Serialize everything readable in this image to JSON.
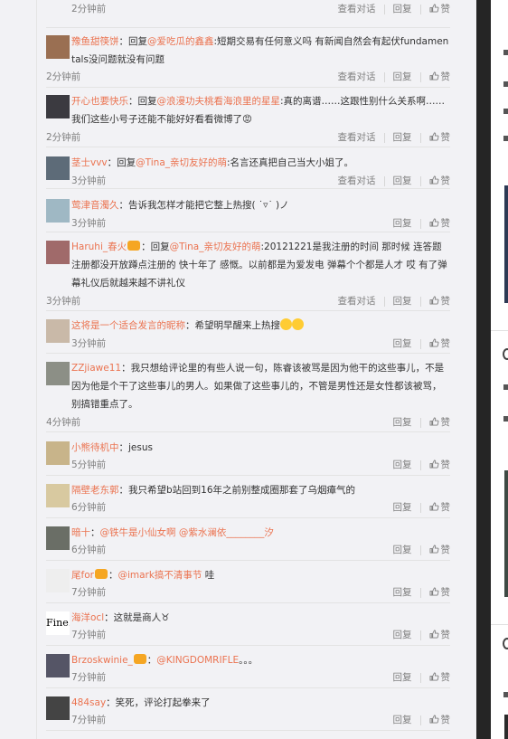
{
  "actions": {
    "view": "查看对话",
    "reply": "回复",
    "like": "赞"
  },
  "comments": [
    {
      "user": "",
      "pre": "",
      "mention": "",
      "text": "",
      "time": "2分钟前",
      "conv": true
    },
    {
      "user": "豫鱼甜筷饼",
      "pre": "回复",
      "mention": "@爱吃瓜的鑫鑫",
      "text": ":短期交易有任何意义吗 有新闻自然会有起伏fundamentals没问题就没有问题",
      "time": "2分钟前",
      "conv": true
    },
    {
      "user": "开心也要快乐",
      "pre": "回复",
      "mention": "@浪漫功夫桃看海浪里的星星",
      "text": ":真的离谱……这跟性别什么关系啊……我们这些小号子还能不能好好看看微博了😡",
      "time": "2分钟前",
      "conv": true
    },
    {
      "user": "茎士vvv",
      "pre": "回复",
      "mention": "@Tina_亲切友好的萌",
      "text": ":名言还真把自己当大小姐了。",
      "time": "3分钟前",
      "conv": true
    },
    {
      "user": "莺津音濁久",
      "pre": "",
      "mention": "",
      "text": "告诉我怎样才能把它整上热搜( ˙▿˙ )ノ",
      "time": "3分钟前",
      "conv": false
    },
    {
      "user": "Haruhi_春火",
      "pre": "回复",
      "mention": "@Tina_亲切友好的萌",
      "text": ":20121221是我注册的时间 那时候 连答题注册都没开放蹲点注册的 快十年了 感慨。以前都是为爱发电 弹幕个个都是人才 哎 有了弹幕礼仪后就越来越不讲礼仪",
      "time": "3分钟前",
      "conv": true,
      "badge": true
    },
    {
      "user": "这将是一个适合发言的昵称",
      "pre": "",
      "mention": "",
      "text": "希望明早醒来上热搜",
      "time": "3分钟前",
      "conv": false,
      "emoji": true
    },
    {
      "user": "ZZjiawe11",
      "pre": "",
      "mention": "",
      "text": "我只想给评论里的有些人说一句，陈睿该被骂是因为他干的这些事儿，不是因为他是个干了这些事儿的男人。如果做了这些事儿的，不管是男性还是女性都该被骂，别搞错重点了。",
      "time": "4分钟前",
      "conv": false
    },
    {
      "user": "小熊待机中",
      "pre": "",
      "mention": "",
      "text": "jesus",
      "time": "5分钟前",
      "conv": false
    },
    {
      "user": "隔壁老东郭",
      "pre": "",
      "mention": "",
      "text": "我只希望b站回到16年之前别整成圈那套了乌烟瘴气的",
      "time": "6分钟前",
      "conv": false
    },
    {
      "user": "暗十",
      "pre": "",
      "mention": "@铁牛是小仙女啊 @紫水澜依________汐",
      "text": "",
      "time": "6分钟前",
      "conv": false
    },
    {
      "user": "尾for",
      "pre": "",
      "mention": "@imark搞不清事节",
      "text": " 哇",
      "time": "7分钟前",
      "conv": false,
      "badge": true
    },
    {
      "user": "海洋ocl",
      "pre": "",
      "mention": "",
      "text": "这就是商人♉",
      "time": "7分钟前",
      "conv": false,
      "avatar_text": "Fine."
    },
    {
      "user": "Brzoskwinie_",
      "pre": "",
      "mention": "@KINGDOMRIFLE",
      "text": "。。。",
      "time": "7分钟前",
      "conv": false,
      "badge": true
    },
    {
      "user": "484say",
      "pre": "",
      "mention": "",
      "text": "笑死，评论打起拳来了",
      "time": "7分钟前",
      "conv": false
    }
  ],
  "colors": {
    "link": "#eb7350",
    "meta": "#808080",
    "text": "#333333"
  }
}
